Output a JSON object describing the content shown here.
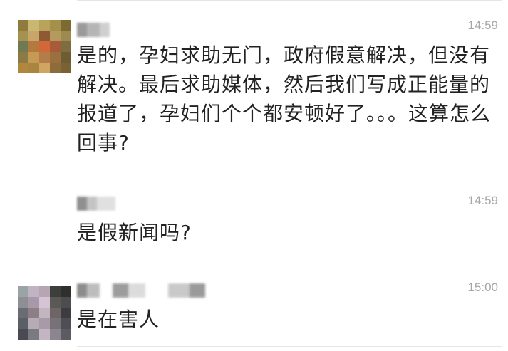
{
  "comments": [
    {
      "time": "14:59",
      "text": "是的，孕妇求助无门，政府假意解决，但没有解决。最后求助媒体，然后我们写成正能量的报道了，孕妇们个个都安顿好了。。。这算怎么回事?",
      "avatar_colors": [
        "#8f7b3c",
        "#c9b871",
        "#b9a35a",
        "#a48f4b",
        "#7d6a33",
        "#a5924e",
        "#c8a66a",
        "#8e5a36",
        "#b49b5d",
        "#9d8a4e",
        "#6f7a52",
        "#b4793e",
        "#d2683a",
        "#a85b3a",
        "#7e6d3f",
        "#8b7a44",
        "#c49a55",
        "#b37c49",
        "#9c6f3f",
        "#6d5d34",
        "#b1863f",
        "#a9853f",
        "#d0a562",
        "#8b6c3a",
        "#7b6234"
      ]
    },
    {
      "time": "14:59",
      "text": "是假新闻吗?"
    },
    {
      "time": "15:00",
      "text": "是在害人",
      "avatar_colors": [
        "#9aa3a6",
        "#c2b3c3",
        "#b8a5b4",
        "#3d3f3d",
        "#2e302d",
        "#8e8f95",
        "#a898a9",
        "#d5c4d3",
        "#5b5956",
        "#4d4d4f",
        "#6a6b73",
        "#8c7f86",
        "#c1b5bf",
        "#6e6566",
        "#3e3c40",
        "#5d5f68",
        "#b6acb6",
        "#a89aa8",
        "#777277",
        "#4f4e55",
        "#4a4b52",
        "#7b7a83",
        "#c3b5c2",
        "#8b8590",
        "#5c5b62"
      ]
    }
  ]
}
